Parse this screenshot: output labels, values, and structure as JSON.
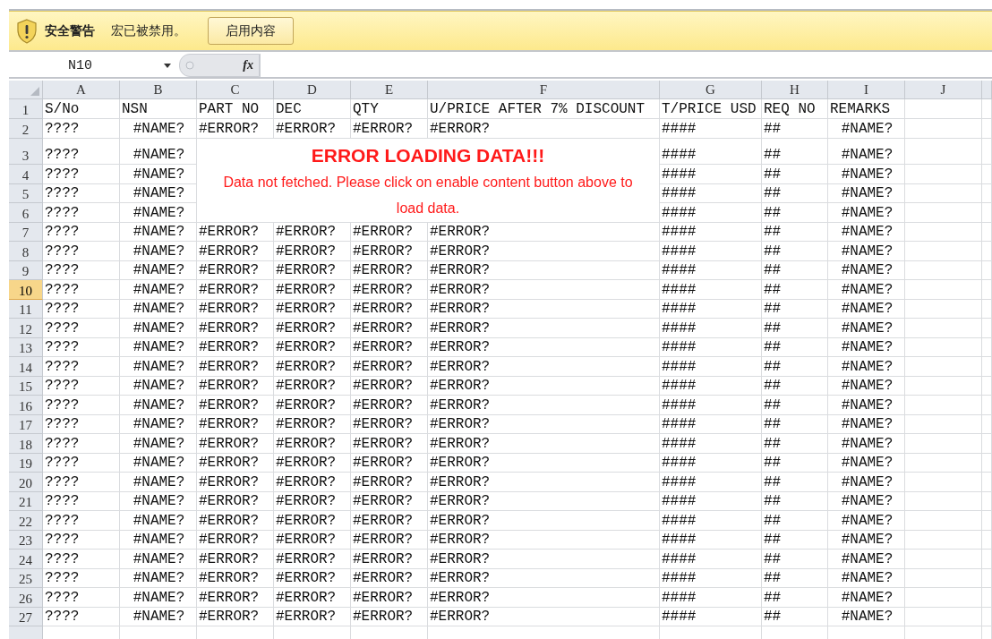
{
  "security_bar": {
    "title": "安全警告",
    "message": "宏已被禁用。",
    "button": "启用内容"
  },
  "formula_bar": {
    "name_box": "N10",
    "function_label": "fx"
  },
  "sheet": {
    "columns": [
      "A",
      "B",
      "C",
      "D",
      "E",
      "F",
      "G",
      "H",
      "I",
      "J"
    ],
    "rows": [
      {
        "number": "1",
        "selected": false,
        "cells": [
          "S/No",
          "NSN",
          "PART NO",
          "DEC",
          "QTY",
          "U/PRICE AFTER 7% DISCOUNT",
          "T/PRICE USD",
          "REQ NO",
          "REMARKS"
        ]
      },
      {
        "number": "2",
        "selected": false,
        "cells": [
          "????",
          "#NAME?",
          "#ERROR?",
          "#ERROR?",
          "#ERROR?",
          "#ERROR?",
          "####",
          "##",
          "#NAME?"
        ]
      },
      {
        "number": "3",
        "selected": false,
        "covered": true,
        "cells": [
          "????",
          "#NAME?",
          "####",
          "##",
          "#NAME?"
        ]
      },
      {
        "number": "4",
        "selected": false,
        "covered": true,
        "cells": [
          "????",
          "#NAME?",
          "####",
          "##",
          "#NAME?"
        ]
      },
      {
        "number": "5",
        "selected": false,
        "covered": true,
        "cells": [
          "????",
          "#NAME?",
          "####",
          "##",
          "#NAME?"
        ]
      },
      {
        "number": "6",
        "selected": false,
        "covered": true,
        "cells": [
          "????",
          "#NAME?",
          "####",
          "##",
          "#NAME?"
        ]
      },
      {
        "number": "7",
        "selected": false,
        "cells": [
          "????",
          "#NAME?",
          "#ERROR?",
          "#ERROR?",
          "#ERROR?",
          "#ERROR?",
          "####",
          "##",
          "#NAME?"
        ]
      },
      {
        "number": "8",
        "selected": false,
        "cells": [
          "????",
          "#NAME?",
          "#ERROR?",
          "#ERROR?",
          "#ERROR?",
          "#ERROR?",
          "####",
          "##",
          "#NAME?"
        ]
      },
      {
        "number": "9",
        "selected": false,
        "cells": [
          "????",
          "#NAME?",
          "#ERROR?",
          "#ERROR?",
          "#ERROR?",
          "#ERROR?",
          "####",
          "##",
          "#NAME?"
        ]
      },
      {
        "number": "10",
        "selected": true,
        "cells": [
          "????",
          "#NAME?",
          "#ERROR?",
          "#ERROR?",
          "#ERROR?",
          "#ERROR?",
          "####",
          "##",
          "#NAME?"
        ]
      },
      {
        "number": "11",
        "selected": false,
        "cells": [
          "????",
          "#NAME?",
          "#ERROR?",
          "#ERROR?",
          "#ERROR?",
          "#ERROR?",
          "####",
          "##",
          "#NAME?"
        ]
      },
      {
        "number": "12",
        "selected": false,
        "cells": [
          "????",
          "#NAME?",
          "#ERROR?",
          "#ERROR?",
          "#ERROR?",
          "#ERROR?",
          "####",
          "##",
          "#NAME?"
        ]
      },
      {
        "number": "13",
        "selected": false,
        "cells": [
          "????",
          "#NAME?",
          "#ERROR?",
          "#ERROR?",
          "#ERROR?",
          "#ERROR?",
          "####",
          "##",
          "#NAME?"
        ]
      },
      {
        "number": "14",
        "selected": false,
        "cells": [
          "????",
          "#NAME?",
          "#ERROR?",
          "#ERROR?",
          "#ERROR?",
          "#ERROR?",
          "####",
          "##",
          "#NAME?"
        ]
      },
      {
        "number": "15",
        "selected": false,
        "cells": [
          "????",
          "#NAME?",
          "#ERROR?",
          "#ERROR?",
          "#ERROR?",
          "#ERROR?",
          "####",
          "##",
          "#NAME?"
        ]
      },
      {
        "number": "16",
        "selected": false,
        "cells": [
          "????",
          "#NAME?",
          "#ERROR?",
          "#ERROR?",
          "#ERROR?",
          "#ERROR?",
          "####",
          "##",
          "#NAME?"
        ]
      },
      {
        "number": "17",
        "selected": false,
        "cells": [
          "????",
          "#NAME?",
          "#ERROR?",
          "#ERROR?",
          "#ERROR?",
          "#ERROR?",
          "####",
          "##",
          "#NAME?"
        ]
      },
      {
        "number": "18",
        "selected": false,
        "cells": [
          "????",
          "#NAME?",
          "#ERROR?",
          "#ERROR?",
          "#ERROR?",
          "#ERROR?",
          "####",
          "##",
          "#NAME?"
        ]
      },
      {
        "number": "19",
        "selected": false,
        "cells": [
          "????",
          "#NAME?",
          "#ERROR?",
          "#ERROR?",
          "#ERROR?",
          "#ERROR?",
          "####",
          "##",
          "#NAME?"
        ]
      },
      {
        "number": "20",
        "selected": false,
        "cells": [
          "????",
          "#NAME?",
          "#ERROR?",
          "#ERROR?",
          "#ERROR?",
          "#ERROR?",
          "####",
          "##",
          "#NAME?"
        ]
      },
      {
        "number": "21",
        "selected": false,
        "cells": [
          "????",
          "#NAME?",
          "#ERROR?",
          "#ERROR?",
          "#ERROR?",
          "#ERROR?",
          "####",
          "##",
          "#NAME?"
        ]
      },
      {
        "number": "22",
        "selected": false,
        "cells": [
          "????",
          "#NAME?",
          "#ERROR?",
          "#ERROR?",
          "#ERROR?",
          "#ERROR?",
          "####",
          "##",
          "#NAME?"
        ]
      },
      {
        "number": "23",
        "selected": false,
        "cells": [
          "????",
          "#NAME?",
          "#ERROR?",
          "#ERROR?",
          "#ERROR?",
          "#ERROR?",
          "####",
          "##",
          "#NAME?"
        ]
      },
      {
        "number": "24",
        "selected": false,
        "cells": [
          "????",
          "#NAME?",
          "#ERROR?",
          "#ERROR?",
          "#ERROR?",
          "#ERROR?",
          "####",
          "##",
          "#NAME?"
        ]
      },
      {
        "number": "25",
        "selected": false,
        "cells": [
          "????",
          "#NAME?",
          "#ERROR?",
          "#ERROR?",
          "#ERROR?",
          "#ERROR?",
          "####",
          "##",
          "#NAME?"
        ]
      },
      {
        "number": "26",
        "selected": false,
        "cells": [
          "????",
          "#NAME?",
          "#ERROR?",
          "#ERROR?",
          "#ERROR?",
          "#ERROR?",
          "####",
          "##",
          "#NAME?"
        ]
      },
      {
        "number": "27",
        "selected": false,
        "cells": [
          "????",
          "#NAME?",
          "#ERROR?",
          "#ERROR?",
          "#ERROR?",
          "#ERROR?",
          "####",
          "##",
          "#NAME?"
        ]
      }
    ],
    "notice": {
      "title": "ERROR LOADING DATA!!!",
      "message": "Data not fetched. Please click on enable content button above to load data."
    }
  }
}
